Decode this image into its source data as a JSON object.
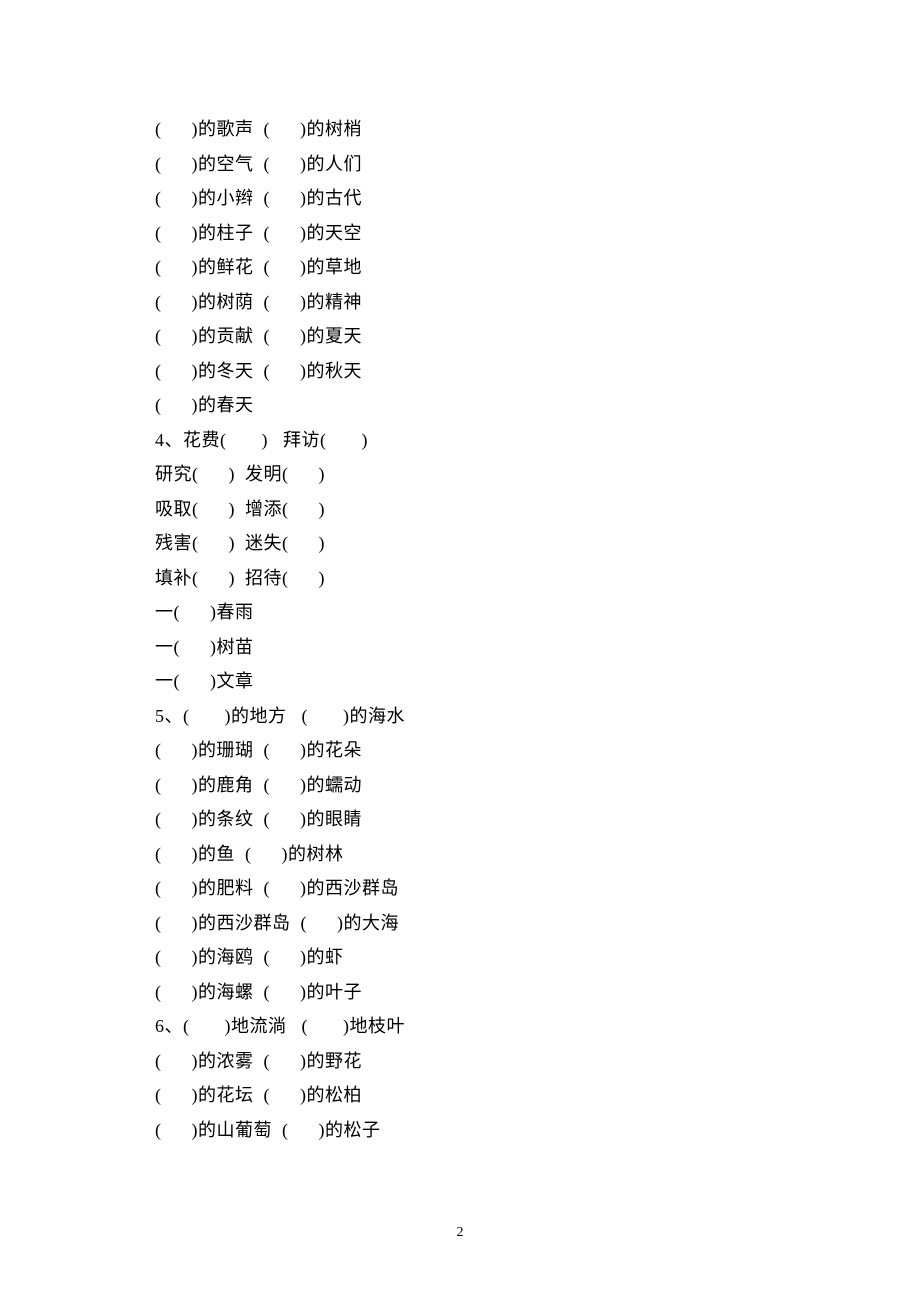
{
  "lines": [
    "(      )的歌声  (      )的树梢",
    "(      )的空气  (      )的人们",
    "(      )的小辫  (      )的古代",
    "(      )的柱子  (      )的天空",
    "(      )的鲜花  (      )的草地",
    "(      )的树荫  (      )的精神",
    "(      )的贡献  (      )的夏天",
    "(      )的冬天  (      )的秋天",
    "(      )的春天",
    "4、花费(       )   拜访(       )",
    "研究(      )  发明(      )",
    "吸取(      )  增添(      )",
    "残害(      )  迷失(      )",
    "填补(      )  招待(      )",
    "一(      )春雨",
    "一(      )树苗",
    "一(      )文章",
    "5、(       )的地方   (       )的海水",
    "(      )的珊瑚  (      )的花朵",
    "(      )的鹿角  (      )的蠕动",
    "(      )的条纹  (      )的眼睛",
    "(      )的鱼  (      )的树林",
    "(      )的肥料  (      )的西沙群岛",
    "(      )的西沙群岛  (      )的大海",
    "(      )的海鸥  (      )的虾",
    "(      )的海螺  (      )的叶子",
    "6、(       )地流淌   (       )地枝叶",
    "(      )的浓雾  (      )的野花",
    "(      )的花坛  (      )的松柏",
    "(      )的山葡萄  (      )的松子"
  ],
  "pageNumber": "2"
}
